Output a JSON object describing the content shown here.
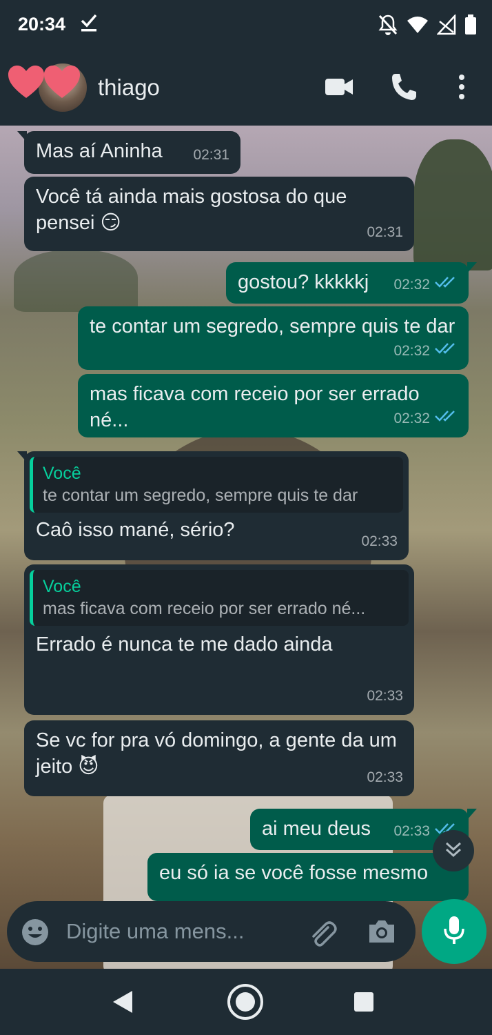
{
  "status_bar": {
    "time": "20:34"
  },
  "header": {
    "contact_name": "thiago"
  },
  "messages": [
    {
      "dir": "in",
      "text": "Mas aí Aninha",
      "time": "02:31"
    },
    {
      "dir": "in",
      "text": "Você tá ainda mais gostosa do que pensei 😏",
      "time": "02:31"
    },
    {
      "dir": "out",
      "text": "gostou? kkkkkj",
      "time": "02:32",
      "status": "read"
    },
    {
      "dir": "out",
      "text": "te contar um segredo, sempre quis te dar",
      "time": "02:32",
      "status": "read"
    },
    {
      "dir": "out",
      "text": "mas ficava com receio por ser errado né...",
      "time": "02:32",
      "status": "read"
    },
    {
      "dir": "in",
      "quote_author": "Você",
      "quote_text": "te contar um segredo, sempre quis te dar",
      "text": "Caô isso mané, sério?",
      "time": "02:33"
    },
    {
      "dir": "in",
      "quote_author": "Você",
      "quote_text": "mas ficava com receio por ser errado né...",
      "text": "Errado é nunca te me dado ainda",
      "time": "02:33"
    },
    {
      "dir": "in",
      "text": "Se vc for pra vó domingo, a gente da um jeito 😈",
      "time": "02:33"
    },
    {
      "dir": "out",
      "text": "ai meu deus",
      "time": "02:33",
      "status": "read"
    },
    {
      "dir": "out",
      "text": "eu só ia se você fosse mesmo",
      "time": "",
      "status": ""
    }
  ],
  "composer": {
    "placeholder": "Digite uma mens..."
  },
  "colors": {
    "incoming_bubble": "#1f2c34",
    "outgoing_bubble": "#005c4b",
    "accent": "#00a884",
    "read_ticks": "#53bdeb",
    "quote_author": "#06cf9c"
  }
}
